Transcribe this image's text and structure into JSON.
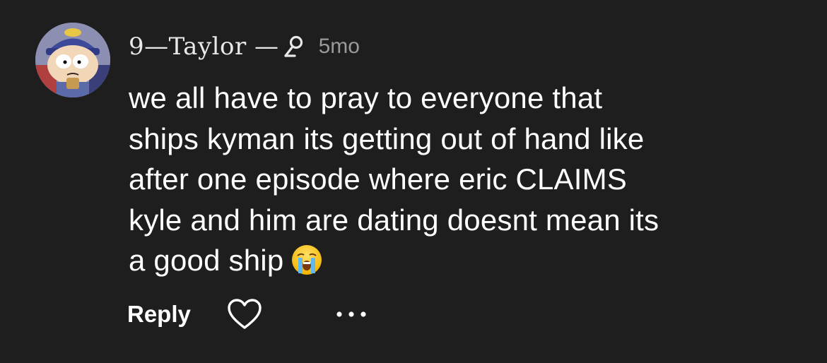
{
  "comment": {
    "username": "9—Taylor —",
    "timestamp": "5mo",
    "text_lines": [
      "we all have to pray to everyone that",
      "ships kyman its getting out of hand like",
      "after one episode where eric CLAIMS",
      "kyle and him are dating doesnt mean its",
      "a good ship"
    ],
    "emoji": "loudly-crying-face-emoji",
    "avatar": "cartoon-character-avatar"
  },
  "actions": {
    "reply_label": "Reply",
    "like_icon": "heart-icon",
    "more_icon": "more-dots-icon"
  },
  "colors": {
    "background": "#1e1e1e",
    "text": "#ffffff",
    "muted": "#9a9a9a"
  }
}
